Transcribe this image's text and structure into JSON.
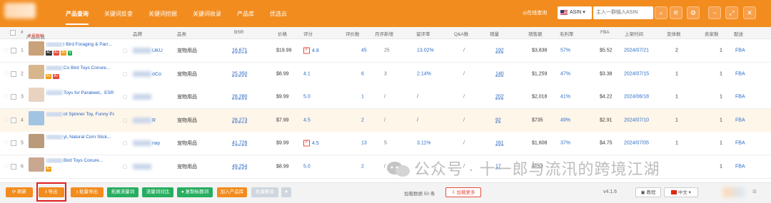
{
  "topbar": {
    "nav": [
      "产品查询",
      "关键词反查",
      "关键词挖掘",
      "关键词收录",
      "产品库",
      "优选云"
    ],
    "online": "◎在线查询",
    "search_type": "ASIN",
    "search_placeholder": "主入一群输入ASIN",
    "buttons": [
      "search-icon",
      "filter-icon",
      "settings-icon",
      "minimize-icon",
      "expand-icon",
      "close-icon"
    ],
    "accent": "#f28c1e"
  },
  "header": {
    "cols": [
      "#",
      "产品信息",
      "品牌",
      "品类",
      "BSR",
      "价格",
      "评分",
      "评价数",
      "月评新增",
      "留评率",
      "Q&A数",
      "销量",
      "销售额",
      "毛利率",
      "FBA",
      "上架时间",
      "变体数",
      "卖家数",
      "配送"
    ],
    "badge": "全部复制"
  },
  "rows": [
    {
      "idx": "1",
      "title": "l Bird Foraging & Parr...",
      "tags": [
        "AC",
        "A+",
        "A+",
        "V"
      ],
      "brand": "UKU",
      "cat": "宠物用品",
      "bsr": "16,671",
      "price": "$19.99",
      "pos": "F",
      "rating": "4.8",
      "reviews": "45",
      "monthly": "25",
      "rate": "13.02%",
      "qa": "/",
      "sales": "192",
      "revenue": "$3,838",
      "margin": "57%",
      "fba": "$5.52",
      "date": "2024/07/21",
      "var": "2",
      "sellers": "1",
      "ship": "FBA",
      "hl": false
    },
    {
      "idx": "2",
      "title": "Co Bird Toys Conure...",
      "tags": [
        "A+",
        "A+"
      ],
      "brand": "oCo",
      "cat": "宠物用品",
      "bsr": "25,350",
      "price": "$8.99",
      "pos": "",
      "rating": "4.1",
      "reviews": "6",
      "monthly": "3",
      "rate": "2.14%",
      "qa": "/",
      "sales": "140",
      "revenue": "$1,259",
      "margin": "47%",
      "fba": "$3.38",
      "date": "2024/07/15",
      "var": "1",
      "sellers": "1",
      "ship": "FBA",
      "hl": false
    },
    {
      "idx": "3",
      "title": "Toys for Parakeet、ESRI...",
      "tags": [],
      "brand": "",
      "cat": "宠物用品",
      "bsr": "28,280",
      "price": "$9.99",
      "pos": "",
      "rating": "5.0",
      "reviews": "1",
      "monthly": "/",
      "rate": "/",
      "qa": "/",
      "sales": "202",
      "revenue": "$2,018",
      "margin": "41%",
      "fba": "$4.22",
      "date": "2024/06/18",
      "var": "1",
      "sellers": "1",
      "ship": "FBA",
      "hl": false
    },
    {
      "idx": "4",
      "title": "ot Spinner Toy, Funny Pa...",
      "tags": [],
      "brand": "R",
      "cat": "宠物用品",
      "bsr": "28,273",
      "price": "$7.99",
      "pos": "",
      "rating": "4.5",
      "reviews": "2",
      "monthly": "/",
      "rate": "/",
      "qa": "/",
      "sales": "92",
      "revenue": "$735",
      "margin": "49%",
      "fba": "$2.91",
      "date": "2024/07/10",
      "var": "1",
      "sellers": "1",
      "ship": "FBA",
      "hl": true
    },
    {
      "idx": "5",
      "title": "yl, Natural Corn Stick...",
      "tags": [],
      "brand": "nay",
      "cat": "宠物用品",
      "bsr": "41,728",
      "price": "$9.99",
      "pos": "F",
      "rating": "4.5",
      "reviews": "13",
      "monthly": "5",
      "rate": "3.11%",
      "qa": "/",
      "sales": "161",
      "revenue": "$1,608",
      "margin": "37%",
      "fba": "$4.75",
      "date": "2024/07/05",
      "var": "1",
      "sellers": "1",
      "ship": "FBA",
      "hl": false
    },
    {
      "idx": "6",
      "title": "Bird Toys Conure...",
      "tags": [
        "A+"
      ],
      "brand": "",
      "cat": "宠物用品",
      "bsr": "49,254",
      "price": "$8.99",
      "pos": "",
      "rating": "5.0",
      "reviews": "2",
      "monthly": "/",
      "rate": "/",
      "qa": "/",
      "sales": "17",
      "revenue": "$153",
      "margin": "",
      "fba": "",
      "date": "",
      "var": "",
      "sellers": "1",
      "ship": "FBA",
      "hl": false
    }
  ],
  "bottom": {
    "buttons": [
      "刷新",
      "导出",
      "批量导出",
      "拓展流量词",
      "流量词对比",
      "复制标题词",
      "加入产品库",
      "批量删除"
    ],
    "loaded": "加载数据 50 条",
    "load_more": "加载更多",
    "version": "v4.1.6",
    "tutorial": "教程",
    "lang": "中文"
  },
  "watermark": "公众号 · 十一郎与流汛的跨境江湖"
}
